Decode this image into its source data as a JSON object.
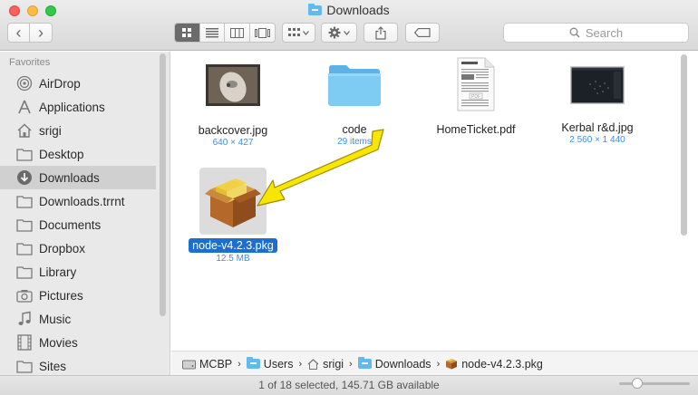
{
  "window": {
    "title": "Downloads"
  },
  "toolbar": {
    "back_glyph": "‹",
    "forward_glyph": "›",
    "search_placeholder": "Search"
  },
  "sidebar": {
    "header": "Favorites",
    "items": [
      {
        "label": "AirDrop",
        "icon": "airdrop-icon"
      },
      {
        "label": "Applications",
        "icon": "applications-icon"
      },
      {
        "label": "srigi",
        "icon": "home-icon"
      },
      {
        "label": "Desktop",
        "icon": "desktop-icon"
      },
      {
        "label": "Downloads",
        "icon": "downloads-icon",
        "selected": true
      },
      {
        "label": "Downloads.trrnt",
        "icon": "folder-icon"
      },
      {
        "label": "Documents",
        "icon": "documents-icon"
      },
      {
        "label": "Dropbox",
        "icon": "folder-icon"
      },
      {
        "label": "Library",
        "icon": "folder-icon"
      },
      {
        "label": "Pictures",
        "icon": "camera-icon"
      },
      {
        "label": "Music",
        "icon": "music-icon"
      },
      {
        "label": "Movies",
        "icon": "movies-icon"
      },
      {
        "label": "Sites",
        "icon": "folder-icon"
      }
    ]
  },
  "files": [
    {
      "name": "backcover.jpg",
      "meta": "640 × 427",
      "icon": "photo-thumbnail"
    },
    {
      "name": "code",
      "meta": "29 items",
      "icon": "folder-icon"
    },
    {
      "name": "HomeTicket.pdf",
      "meta": "",
      "icon": "pdf-thumbnail"
    },
    {
      "name": "Kerbal r&d.jpg",
      "meta": "2 560 × 1 440",
      "icon": "screenshot-thumbnail"
    },
    {
      "name": "node-v4.2.3.pkg",
      "meta": "12.5 MB",
      "icon": "package-icon",
      "selected": true
    }
  ],
  "pathbar": {
    "segments": [
      "MCBP",
      "Users",
      "srigi",
      "Downloads",
      "node-v4.2.3.pkg"
    ]
  },
  "status": {
    "text": "1 of 18 selected, 145.71 GB available"
  },
  "colors": {
    "selection": "#1a6fd1",
    "folder": "#66bdf0",
    "arrow": "#f6e600"
  }
}
